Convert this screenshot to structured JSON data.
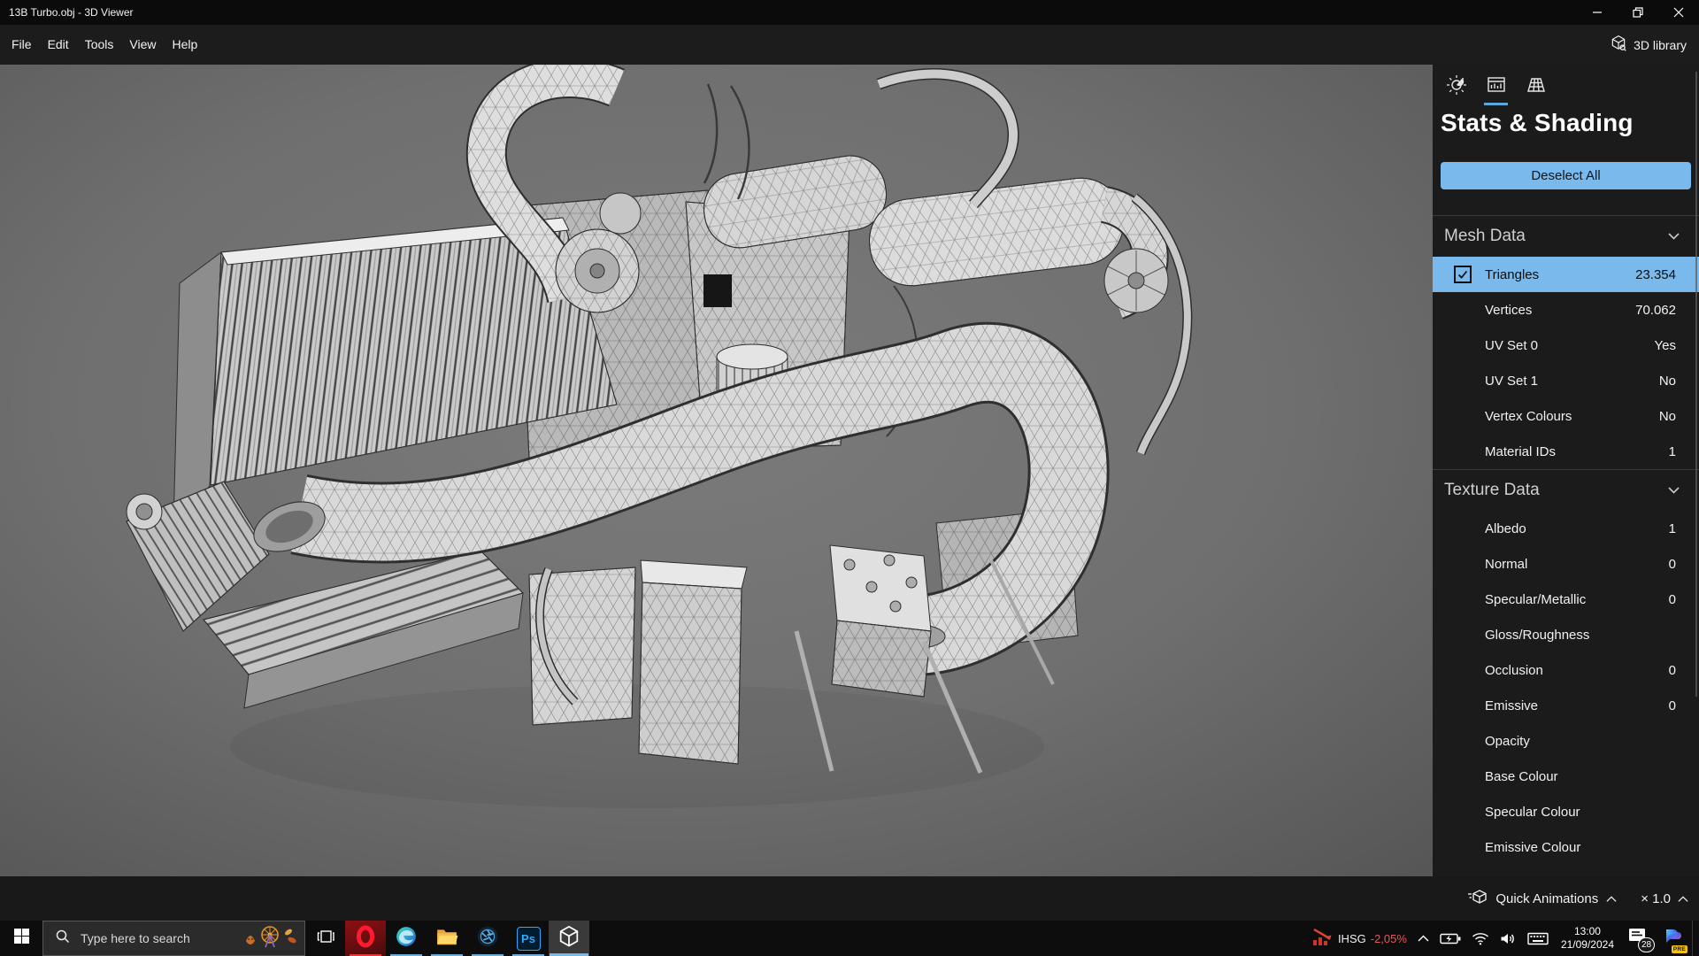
{
  "window": {
    "title": "13B Turbo.obj - 3D Viewer"
  },
  "menubar": {
    "items": [
      "File",
      "Edit",
      "Tools",
      "View",
      "Help"
    ],
    "library_button": "3D library"
  },
  "panel": {
    "tabs": [
      "environment-lighting",
      "stats-shading",
      "grid-view"
    ],
    "active_tab": "stats-shading",
    "title": "Stats & Shading",
    "deselect_button": "Deselect All",
    "sections": [
      {
        "title": "Mesh Data",
        "rows": [
          {
            "label": "Triangles",
            "value": "23.354",
            "checkbox": true,
            "selected": true
          },
          {
            "label": "Vertices",
            "value": "70.062"
          },
          {
            "label": "UV Set 0",
            "value": "Yes"
          },
          {
            "label": "UV Set 1",
            "value": "No"
          },
          {
            "label": "Vertex Colours",
            "value": "No"
          },
          {
            "label": "Material IDs",
            "value": "1"
          }
        ]
      },
      {
        "title": "Texture Data",
        "rows": [
          {
            "label": "Albedo",
            "value": "1"
          },
          {
            "label": "Normal",
            "value": "0"
          },
          {
            "label": "Specular/Metallic",
            "value": "0"
          },
          {
            "label": "Gloss/Roughness",
            "value": ""
          },
          {
            "label": "Occlusion",
            "value": "0"
          },
          {
            "label": "Emissive",
            "value": "0"
          },
          {
            "label": "Opacity",
            "value": ""
          },
          {
            "label": "Base Colour",
            "value": ""
          },
          {
            "label": "Specular Colour",
            "value": ""
          },
          {
            "label": "Emissive Colour",
            "value": ""
          }
        ]
      }
    ]
  },
  "animation_bar": {
    "label": "Quick Animations",
    "speed_label": "× 1.0"
  },
  "taskbar": {
    "search": {
      "placeholder": "Type here to search"
    },
    "apps": [
      "task-view",
      "opera",
      "edge",
      "file-explorer",
      "shutter-app",
      "photoshop",
      "3d-viewer"
    ],
    "active_app": "3d-viewer",
    "photoshop_label": "Ps",
    "tray": {
      "stock": {
        "symbol": "IHSG",
        "change": "-2,05%"
      },
      "time": "13:00",
      "date": "21/09/2024",
      "notifications_badge": "28",
      "copilot_badge": "PRE"
    }
  },
  "colors": {
    "accent_blue": "#79b9eb",
    "tab_underline": "#5aa7dd",
    "selected_row_text": "#0d0d0d",
    "stock_red": "#e2595f",
    "opera_red": "#e33b3b",
    "copilot_badge_yellow": "#f2c011",
    "viewport_gray": "#6e6e6e"
  }
}
